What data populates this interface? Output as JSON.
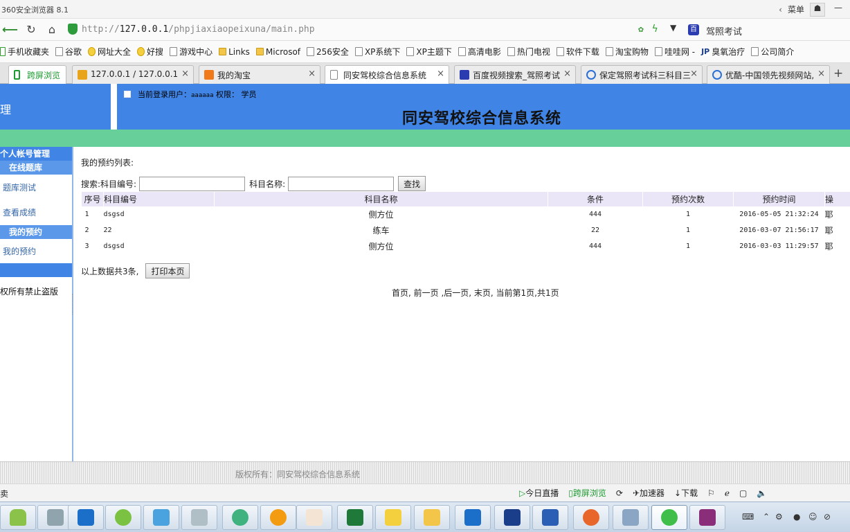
{
  "browser": {
    "title": "360安全浏览器 8.1",
    "menu": "菜单",
    "url_prefix": "http://",
    "url_host": "127.0.0.1",
    "url_path": "/phpjiaxiaopeixuna/main.php",
    "search_text": "驾照考试"
  },
  "bookmarks": [
    {
      "label": "手机收藏夹",
      "icon": "phone"
    },
    {
      "label": "谷歌",
      "icon": "page"
    },
    {
      "label": "网址大全",
      "icon": "circ"
    },
    {
      "label": "好搜",
      "icon": "circ"
    },
    {
      "label": "游戏中心",
      "icon": "page"
    },
    {
      "label": "Links",
      "icon": "fold"
    },
    {
      "label": "Microsof",
      "icon": "fold"
    },
    {
      "label": "256安全",
      "icon": "page"
    },
    {
      "label": "XP系统下",
      "icon": "page"
    },
    {
      "label": "XP主题下",
      "icon": "page"
    },
    {
      "label": "高清电影",
      "icon": "page"
    },
    {
      "label": "热门电视",
      "icon": "page"
    },
    {
      "label": "软件下载",
      "icon": "page"
    },
    {
      "label": "淘宝购物",
      "icon": "page"
    },
    {
      "label": "哇哇网 -",
      "icon": "page"
    },
    {
      "label": "臭氧治疗",
      "icon": "jp",
      "icon_text": "JP"
    },
    {
      "label": "公司简介",
      "icon": "page"
    }
  ],
  "tabs": {
    "kuaping": "跨屏浏览",
    "t1": "127.0.0.1 / 127.0.0.1",
    "t2": "我的淘宝",
    "t3": "同安驾校综合信息系统",
    "t4": "百度视频搜索_驾照考试",
    "t5": "保定驾照考试科三科目三",
    "t6": "优酷-中国领先视频网站,"
  },
  "app": {
    "header_left": "理",
    "login_label": "当前登录用户：",
    "username": "aaaaaa",
    "perm_label": " 权限：",
    "role": "学员",
    "system_title": "同安驾校综合信息系统"
  },
  "sidebar": {
    "account": "个人帐号管理",
    "question_bank": "在线题库",
    "quiz": "题库测试",
    "scores": "查看成绩",
    "my_booking_head": "我的预约",
    "my_booking": "我的预约",
    "footer": "权所有禁止盗版"
  },
  "main": {
    "list_title": "我的预约列表:",
    "search_label": "搜索:科目编号:",
    "name_label": "科目名称:",
    "search_button": "查找",
    "columns": [
      "序号",
      "科目编号",
      "科目名称",
      "条件",
      "预约次数",
      "预约时间",
      "操"
    ],
    "rows": [
      {
        "no": "1",
        "code": "dsgsd",
        "name": "侧方位",
        "cond": "444",
        "times": "1",
        "time": "2016-05-05 21:32:24",
        "op": "耶"
      },
      {
        "no": "2",
        "code": "22",
        "name": "练车",
        "cond": "22",
        "times": "1",
        "time": "2016-03-07 21:56:17",
        "op": "耶"
      },
      {
        "no": "3",
        "code": "dsgsd",
        "name": "侧方位",
        "cond": "444",
        "times": "1",
        "time": "2016-03-03 11:29:57",
        "op": "耶"
      }
    ],
    "total_text": "以上数据共3条,",
    "print_button": "打印本页",
    "pager": "首页, 前一页 ,后一页, 末页, 当前第1页,共1页"
  },
  "footer": {
    "copyright": "版权所有：同安驾校综合信息系统"
  },
  "statusbar": {
    "left": "卖",
    "live": "今日直播",
    "cross": "跨屏浏览",
    "accel": "加速器",
    "download": "下载"
  }
}
